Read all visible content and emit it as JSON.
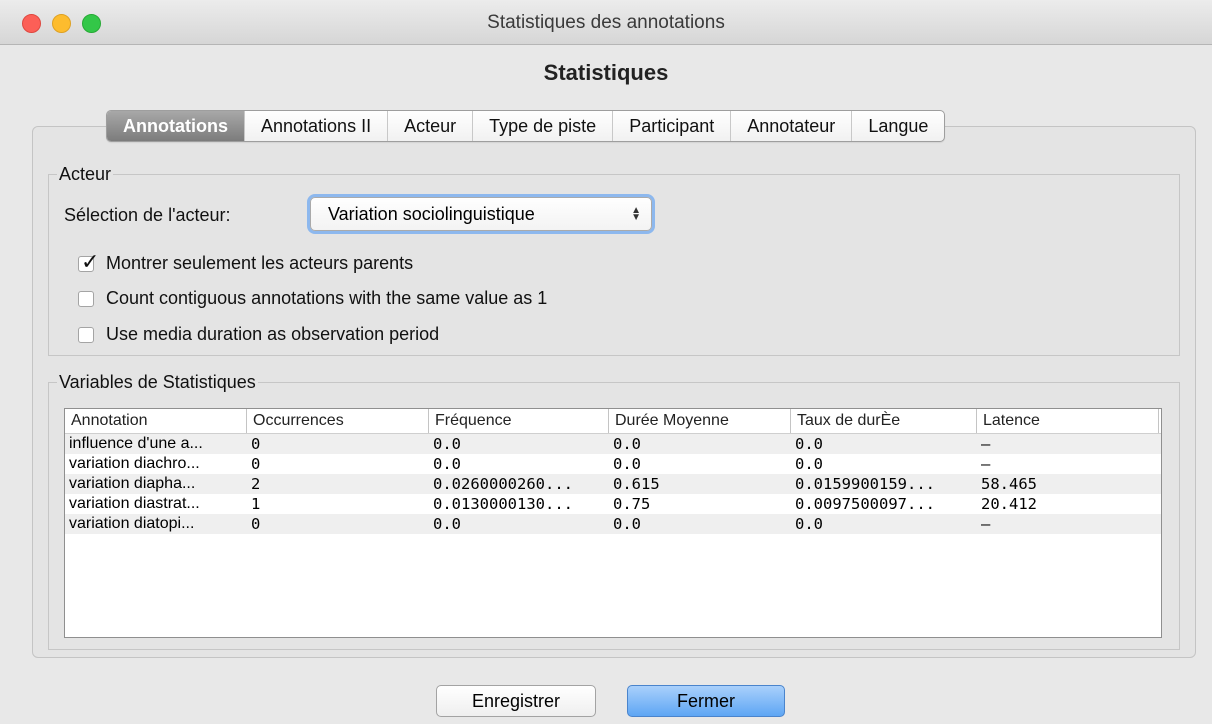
{
  "window": {
    "title": "Statistiques des annotations"
  },
  "heading": "Statistiques",
  "tabs": [
    {
      "label": "Annotations",
      "active": true
    },
    {
      "label": "Annotations II",
      "active": false
    },
    {
      "label": "Acteur",
      "active": false
    },
    {
      "label": "Type de piste",
      "active": false
    },
    {
      "label": "Participant",
      "active": false
    },
    {
      "label": "Annotateur",
      "active": false
    },
    {
      "label": "Langue",
      "active": false
    }
  ],
  "acteur_group": {
    "legend": "Acteur",
    "select_label": "Sélection de l'acteur:",
    "select_value": "Variation sociolinguistique",
    "options": [
      {
        "label": "Montrer seulement les acteurs parents",
        "checked": true
      },
      {
        "label": "Count contiguous annotations with the same value as 1",
        "checked": false
      },
      {
        "label": "Use media duration as observation period",
        "checked": false
      }
    ]
  },
  "stats_group": {
    "legend": "Variables de Statistiques",
    "columns": [
      "Annotation",
      "Occurrences",
      "Fréquence",
      "Durée Moyenne",
      "Taux de durÈe",
      "Latence"
    ],
    "rows": [
      [
        "influence d'une a...",
        "0",
        "0.0",
        "0.0",
        "0.0",
        "–"
      ],
      [
        "variation diachro...",
        "0",
        "0.0",
        "0.0",
        "0.0",
        "–"
      ],
      [
        "variation diapha...",
        "2",
        "0.0260000260...",
        "0.615",
        "0.0159900159...",
        "58.465"
      ],
      [
        "variation diastrat...",
        "1",
        "0.0130000130...",
        "0.75",
        "0.0097500097...",
        "20.412"
      ],
      [
        "variation diatopi...",
        "0",
        "0.0",
        "0.0",
        "0.0",
        "–"
      ]
    ]
  },
  "buttons": {
    "save": "Enregistrer",
    "close": "Fermer"
  },
  "colors": {
    "accent": "#5ea6f4",
    "focus_ring": "#8db8ee",
    "active_tab": "#8c8c8c"
  }
}
